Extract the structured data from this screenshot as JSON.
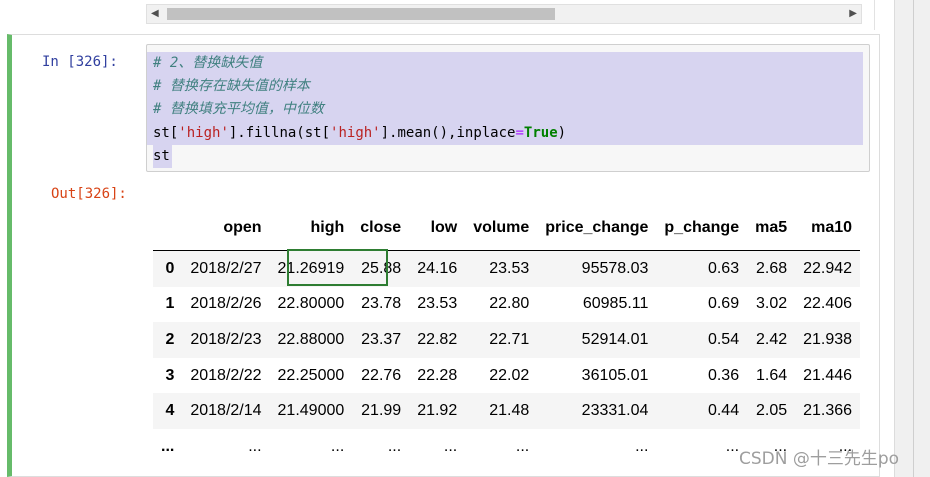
{
  "scroll": {
    "left_arrow": "◀",
    "right_arrow": "▶"
  },
  "cell": {
    "in_prompt": "In  [326]:",
    "out_prompt": "Out[326]:",
    "code": {
      "comment1": "# 2、替换缺失值",
      "comment2": "# 替换存在缺失值的样本",
      "comment3": "# 替换填充平均值，中位数",
      "line4": {
        "a": "st[",
        "s1": "'high'",
        "b": "].fillna(st[",
        "s2": "'high'",
        "c": "].mean(),inplace",
        "eq": "=",
        "kw": "True",
        "d": ")"
      },
      "line5": "st"
    }
  },
  "table": {
    "columns": [
      "",
      "open",
      "high",
      "close",
      "low",
      "volume",
      "price_change",
      "p_change",
      "ma5",
      "ma10"
    ],
    "rows": [
      [
        "0",
        "2018/2/27",
        "21.26919",
        "25.88",
        "24.16",
        "23.53",
        "95578.03",
        "0.63",
        "2.68",
        "22.942"
      ],
      [
        "1",
        "2018/2/26",
        "22.80000",
        "23.78",
        "23.53",
        "22.80",
        "60985.11",
        "0.69",
        "3.02",
        "22.406"
      ],
      [
        "2",
        "2018/2/23",
        "22.88000",
        "23.37",
        "22.82",
        "22.71",
        "52914.01",
        "0.54",
        "2.42",
        "21.938"
      ],
      [
        "3",
        "2018/2/22",
        "22.25000",
        "22.76",
        "22.28",
        "22.02",
        "36105.01",
        "0.36",
        "1.64",
        "21.446"
      ],
      [
        "4",
        "2018/2/14",
        "21.49000",
        "21.99",
        "21.92",
        "21.48",
        "23331.04",
        "0.44",
        "2.05",
        "21.366"
      ],
      [
        "...",
        "...",
        "...",
        "...",
        "...",
        "...",
        "...",
        "...",
        "...",
        "..."
      ]
    ]
  },
  "watermark": "CSDN @十三先生po"
}
